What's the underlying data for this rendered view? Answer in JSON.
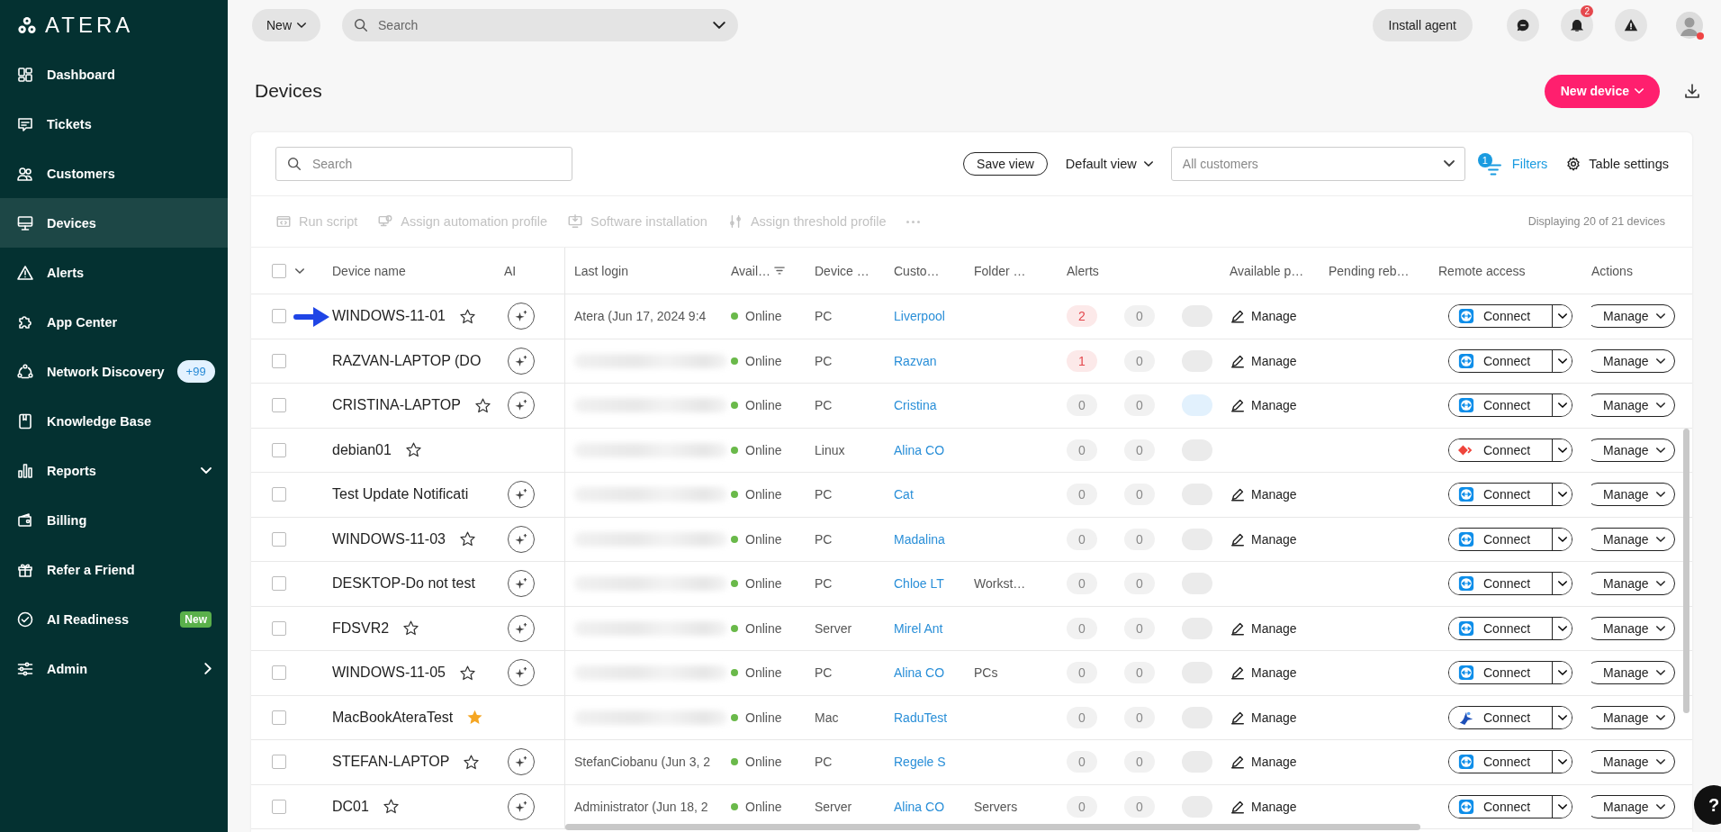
{
  "sidebar": {
    "logo": "ATERA",
    "items": [
      {
        "label": "Dashboard",
        "selected": false,
        "kind": "plain"
      },
      {
        "label": "Tickets",
        "selected": false,
        "kind": "plain"
      },
      {
        "label": "Customers",
        "selected": false,
        "kind": "plain"
      },
      {
        "label": "Devices",
        "selected": true,
        "kind": "plain"
      },
      {
        "label": "Alerts",
        "selected": false,
        "kind": "plain"
      },
      {
        "label": "App Center",
        "selected": false,
        "kind": "plain"
      },
      {
        "label": "Network Discovery",
        "selected": false,
        "kind": "count",
        "badge": "+99"
      },
      {
        "label": "Knowledge Base",
        "selected": false,
        "kind": "plain"
      },
      {
        "label": "Reports",
        "selected": false,
        "kind": "group"
      },
      {
        "label": "Billing",
        "selected": false,
        "kind": "plain"
      },
      {
        "label": "Refer a Friend",
        "selected": false,
        "kind": "plain"
      },
      {
        "label": "AI Readiness",
        "selected": false,
        "kind": "new",
        "badge": "New"
      },
      {
        "label": "Admin",
        "selected": false,
        "kind": "submenu"
      }
    ]
  },
  "topbar": {
    "new_button": "New",
    "search": {
      "placeholder": "Search"
    },
    "install_button": "Install agent",
    "notification_count": "2"
  },
  "page": {
    "title": "Devices",
    "new_device_button": "New device"
  },
  "toolbar": {
    "search": {
      "placeholder": "Search"
    },
    "save_view": "Save view",
    "view_select": "Default view",
    "customer_select": {
      "placeholder": "All customers"
    },
    "filters": {
      "label": "Filters",
      "count": "1"
    },
    "table_settings": "Table settings"
  },
  "actions": [
    {
      "label": "Run script",
      "disabled": true
    },
    {
      "label": "Assign automation profile",
      "disabled": true
    },
    {
      "label": "Software installation",
      "disabled": true
    },
    {
      "label": "Assign threshold profile",
      "disabled": true
    }
  ],
  "display_count": "Displaying 20 of 21 devices",
  "table": {
    "all_selected": false,
    "columns": [
      "Device name",
      "AI",
      "Last login",
      "Avail…",
      "Device …",
      "Custo…",
      "Folder …",
      "Alerts",
      "Available p…",
      "Pending reb…",
      "Remote access",
      "Actions"
    ],
    "rows": [
      {
        "selected": false,
        "pointer": true,
        "name": "WINDOWS-11-01",
        "favorite": false,
        "ai": true,
        "last_login": "Atera (Jun 17, 2024 9:4",
        "status": "Online",
        "type": "PC",
        "customer": "Liverpool",
        "alerts": [
          {
            "text": "2",
            "color": "#e3474c"
          },
          {
            "text": "0",
            "color": "#888888"
          },
          {
            "color": "#ebebeb"
          }
        ],
        "patches": "Manage",
        "remote": {
          "label": "Connect",
          "kind": "teamviewer"
        },
        "action": "Manage"
      },
      {
        "selected": false,
        "name": "RAZVAN-LAPTOP (DO",
        "ai": true,
        "last_login_hidden": true,
        "status": "Online",
        "type": "PC",
        "customer": "Razvan",
        "alerts": [
          {
            "text": "1",
            "color": "#e3474c"
          },
          {
            "text": "0",
            "color": "#888888"
          },
          {
            "color": "#ebebeb"
          }
        ],
        "patches": "Manage",
        "remote": {
          "label": "Connect",
          "kind": "teamviewer"
        },
        "action": "Manage"
      },
      {
        "selected": false,
        "name": "CRISTINA-LAPTOP",
        "favorite": false,
        "ai": true,
        "last_login_hidden": true,
        "status": "Online",
        "type": "PC",
        "customer": "Cristina",
        "alerts": [
          {
            "text": "0",
            "color": "#888888"
          },
          {
            "text": "0",
            "color": "#888888"
          },
          {
            "color": "#e2f1fd"
          }
        ],
        "patches": "Manage",
        "remote": {
          "label": "Connect",
          "kind": "teamviewer"
        },
        "action": "Manage"
      },
      {
        "selected": false,
        "name": "debian01",
        "favorite": false,
        "ai": false,
        "last_login_hidden": true,
        "status": "Online",
        "type": "Linux",
        "customer": "Alina CO",
        "alerts": [
          {
            "text": "0",
            "color": "#888888"
          },
          {
            "text": "0",
            "color": "#888888"
          },
          {
            "color": "#ebebeb"
          }
        ],
        "remote": {
          "label": "Connect",
          "kind": "anydesk"
        },
        "action": "Manage"
      },
      {
        "selected": false,
        "name": "Test Update Notificati",
        "ai": true,
        "last_login_hidden": true,
        "status": "Online",
        "type": "PC",
        "customer": "Cat",
        "alerts": [
          {
            "text": "0",
            "color": "#888888"
          },
          {
            "text": "0",
            "color": "#888888"
          },
          {
            "color": "#ebebeb"
          }
        ],
        "patches": "Manage",
        "remote": {
          "label": "Connect",
          "kind": "teamviewer"
        },
        "action": "Manage"
      },
      {
        "selected": false,
        "name": "WINDOWS-11-03",
        "favorite": false,
        "ai": true,
        "last_login_hidden": true,
        "status": "Online",
        "type": "PC",
        "customer": "Madalina",
        "alerts": [
          {
            "text": "0",
            "color": "#888888"
          },
          {
            "text": "0",
            "color": "#888888"
          },
          {
            "color": "#ebebeb"
          }
        ],
        "patches": "Manage",
        "remote": {
          "label": "Connect",
          "kind": "teamviewer"
        },
        "action": "Manage"
      },
      {
        "selected": false,
        "name": "DESKTOP-Do not test",
        "ai": true,
        "last_login_hidden": true,
        "status": "Online",
        "type": "PC",
        "customer": "Chloe LT",
        "folder": "Workst…",
        "alerts": [
          {
            "text": "0",
            "color": "#888888"
          },
          {
            "text": "0",
            "color": "#888888"
          },
          {
            "color": "#ebebeb"
          }
        ],
        "remote": {
          "label": "Connect",
          "kind": "teamviewer"
        },
        "action": "Manage"
      },
      {
        "selected": false,
        "name": "FDSVR2",
        "favorite": false,
        "ai": true,
        "last_login_hidden": true,
        "status": "Online",
        "type": "Server",
        "customer": "Mirel Ant",
        "alerts": [
          {
            "text": "0",
            "color": "#888888"
          },
          {
            "text": "0",
            "color": "#888888"
          },
          {
            "color": "#ebebeb"
          }
        ],
        "patches": "Manage",
        "remote": {
          "label": "Connect",
          "kind": "teamviewer"
        },
        "action": "Manage"
      },
      {
        "selected": false,
        "name": "WINDOWS-11-05",
        "favorite": false,
        "ai": true,
        "last_login_hidden": true,
        "status": "Online",
        "type": "PC",
        "customer": "Alina CO",
        "folder": "PCs",
        "alerts": [
          {
            "text": "0",
            "color": "#888888"
          },
          {
            "text": "0",
            "color": "#888888"
          },
          {
            "color": "#ebebeb"
          }
        ],
        "patches": "Manage",
        "remote": {
          "label": "Connect",
          "kind": "teamviewer"
        },
        "action": "Manage"
      },
      {
        "selected": false,
        "name": "MacBookAteraTest",
        "favorite": true,
        "ai": false,
        "last_login_hidden": true,
        "status": "Online",
        "type": "Mac",
        "customer": "RaduTest",
        "alerts": [
          {
            "text": "0",
            "color": "#888888"
          },
          {
            "text": "0",
            "color": "#888888"
          },
          {
            "color": "#ebebeb"
          }
        ],
        "patches": "Manage",
        "remote": {
          "label": "Connect",
          "kind": "splashtop"
        },
        "action": "Manage"
      },
      {
        "selected": false,
        "name": "STEFAN-LAPTOP",
        "favorite": false,
        "ai": true,
        "last_login": "StefanCiobanu (Jun 3, 2",
        "status": "Online",
        "type": "PC",
        "customer": "Regele S",
        "alerts": [
          {
            "text": "0",
            "color": "#888888"
          },
          {
            "text": "0",
            "color": "#888888"
          },
          {
            "color": "#ebebeb"
          }
        ],
        "patches": "Manage",
        "remote": {
          "label": "Connect",
          "kind": "teamviewer"
        },
        "action": "Manage"
      },
      {
        "selected": false,
        "name": "DC01",
        "favorite": false,
        "ai": true,
        "last_login": "Administrator (Jun 18, 2",
        "status": "Online",
        "type": "Server",
        "customer": "Alina CO",
        "folder": "Servers",
        "alerts": [
          {
            "text": "0",
            "color": "#888888"
          },
          {
            "text": "0",
            "color": "#888888"
          },
          {
            "color": "#ebebeb"
          }
        ],
        "patches": "Manage",
        "remote": {
          "label": "Connect",
          "kind": "teamviewer"
        },
        "action": "Manage"
      }
    ]
  },
  "help_button": "?"
}
